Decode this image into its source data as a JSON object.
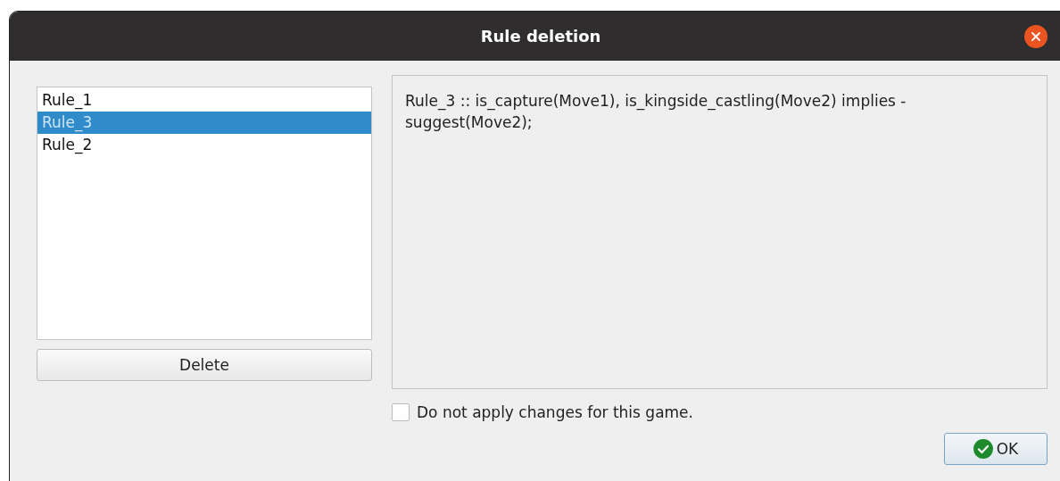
{
  "window": {
    "title": "Rule deletion"
  },
  "rules": [
    {
      "label": "Rule_1",
      "selected": false
    },
    {
      "label": "Rule_3",
      "selected": true
    },
    {
      "label": "Rule_2",
      "selected": false
    }
  ],
  "delete_button": "Delete",
  "rule_text": "Rule_3 :: is_capture(Move1), is_kingside_castling(Move2) implies - suggest(Move2);",
  "option": {
    "label": "Do not apply changes for this game.",
    "checked": false
  },
  "ok_button": "OK"
}
